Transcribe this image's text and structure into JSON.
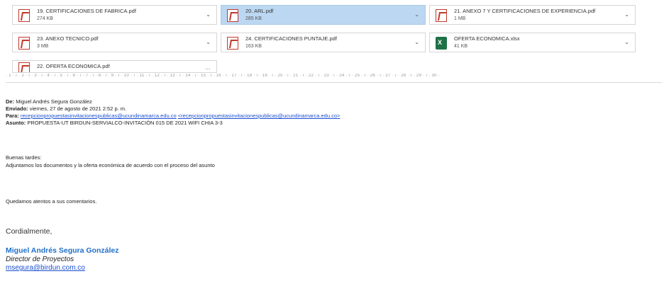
{
  "attachments": [
    {
      "name": "19. CERTIFICACIONES DE FABRICA.pdf",
      "size": "274 KB",
      "type": "pdf",
      "selected": false
    },
    {
      "name": "20. ARL.pdf",
      "size": "285 KB",
      "type": "pdf",
      "selected": true
    },
    {
      "name": "21. ANEXO 7 Y CERTIFICACIONES DE EXPERIENCIA.pdf",
      "size": "1 MB",
      "type": "pdf",
      "selected": false
    },
    {
      "name": "23. ANEXO TECNICO.pdf",
      "size": "3 MB",
      "type": "pdf",
      "selected": false
    },
    {
      "name": "24. CERTIFICACIONES PUNTAJE.pdf",
      "size": "163 KB",
      "type": "pdf",
      "selected": false
    },
    {
      "name": "OFERTA ECONOMICA.xlsx",
      "size": "41 KB",
      "type": "xlsx",
      "selected": false
    },
    {
      "name": "22. OFERTA ECONOMICA.pdf",
      "size": "",
      "type": "pdf",
      "selected": false
    }
  ],
  "ruler": {
    "text": "· 1 · ı · 2 · ı · 3 · ı · 4 · ı · 5 · ı · 6 · ı · 7 · ı · 8 · ı · 9 · ı · 10 · ı · 11 · ı · 12 · ı · 13 · ı · 14 · ı · 15 · ı · 16 · ı · 17 · ı · 18 · ı · 19 · ı · 20 · ı · 21 · ı · 22 · ı · 23 · ı · 24 · ı · 25 · ı · 26 · ı · 27 · ı · 28 · ı · 29 · ı · 30 ·"
  },
  "header": {
    "from_label": "De:",
    "from": "Miguel Andrés Segura González",
    "sent_label": "Enviado:",
    "sent": "viernes, 27 de agosto de 2021 2:52 p. m.",
    "to_label": "Para:",
    "to_1": "recepcionpropuestasinvitacionespublicas@ucundinamarca.edu.co",
    "to_2": "<recepcionpropuestasinvitacionespublicas@ucundinamarca.edu.co>",
    "subject_label": "Asunto:",
    "subject": "PROPUESTA-UT BIRDUN-SERVIALCO-INVITACIÓN 015 DE 2021 WIFI CHIA 3-3"
  },
  "body": {
    "greeting": "Buenas tardes:",
    "line1": "Adjuntamos los documentos y la oferta económica de acuerdo  con el proceso del asunto",
    "line2": "Quedamos atentos a sus comentarios.",
    "closing": "Cordialmente,"
  },
  "signature": {
    "name": "Miguel Andrés Segura González",
    "title": "Director de Proyectos",
    "email": "msegura@birdun.com.co"
  }
}
